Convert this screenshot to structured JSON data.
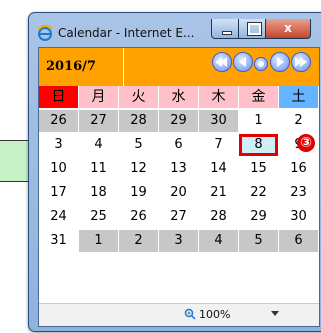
{
  "window": {
    "title": "Calendar - Internet E...",
    "close_label": "x"
  },
  "calendar": {
    "year_month": "2016/7",
    "weekdays": [
      "日",
      "月",
      "火",
      "水",
      "木",
      "金",
      "土"
    ],
    "weeks": [
      [
        "26",
        "27",
        "28",
        "29",
        "30",
        "1",
        "2"
      ],
      [
        "3",
        "4",
        "5",
        "6",
        "7",
        "8",
        "9"
      ],
      [
        "10",
        "11",
        "12",
        "13",
        "14",
        "15",
        "16"
      ],
      [
        "17",
        "18",
        "19",
        "20",
        "21",
        "22",
        "23"
      ],
      [
        "24",
        "25",
        "26",
        "27",
        "28",
        "29",
        "30"
      ],
      [
        "31",
        "1",
        "2",
        "3",
        "4",
        "5",
        "6"
      ]
    ],
    "selected_day": "8",
    "annotation_number": "③"
  },
  "statusbar": {
    "zoom": "100%"
  },
  "colors": {
    "header": "#ffa200",
    "sunday": "#ff0000",
    "saturday": "#66b3ff",
    "weekday": "#ffc0cb",
    "other_month": "#c7c7c7",
    "today_border": "#e00000"
  },
  "icons": [
    "ie-icon",
    "minimize-icon",
    "maximize-icon",
    "close-icon",
    "nav-first-icon",
    "nav-prev-icon",
    "nav-today-icon",
    "nav-next-icon",
    "nav-last-icon",
    "zoom-icon",
    "dropdown-caret-icon"
  ]
}
